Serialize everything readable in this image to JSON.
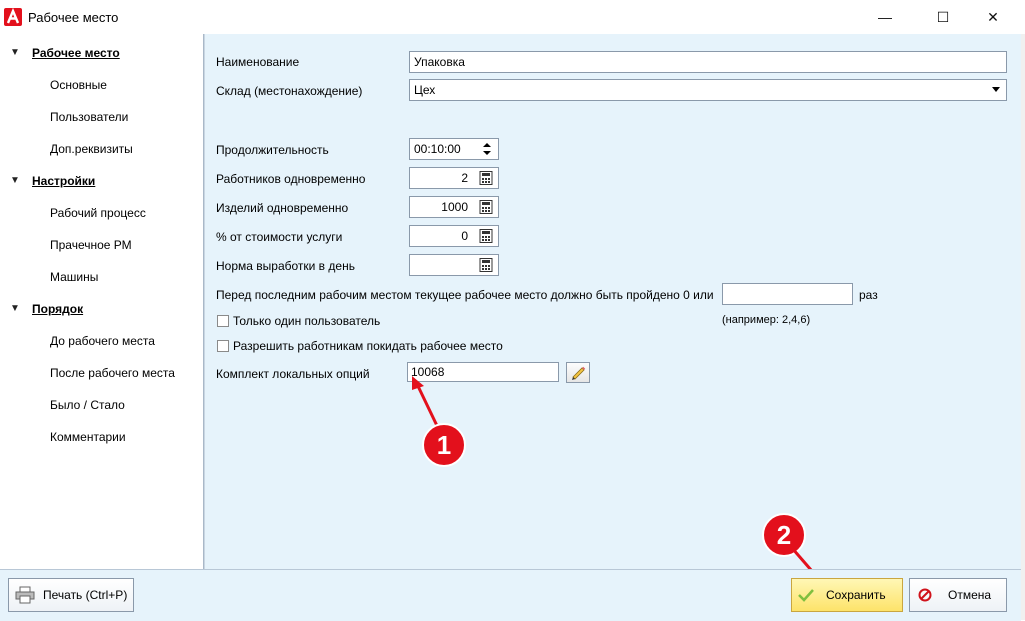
{
  "window": {
    "title": "Рабочее место",
    "controls": {
      "minimize": "—",
      "maximize": "☐",
      "close": "✕"
    }
  },
  "sidebar": {
    "groups": [
      {
        "label": "Рабочее место",
        "items": [
          "Основные",
          "Пользователи",
          "Доп.реквизиты"
        ]
      },
      {
        "label": "Настройки",
        "items": [
          "Рабочий процесс",
          "Прачечное РМ",
          "Машины"
        ]
      },
      {
        "label": "Порядок",
        "items": [
          "До рабочего места",
          "После рабочего места",
          "Было / Стало",
          "Комментарии"
        ]
      }
    ]
  },
  "form": {
    "name_label": "Наименование",
    "name_value": "Упаковка",
    "warehouse_label": "Склад (местонахождение)",
    "warehouse_value": "Цех",
    "duration_label": "Продолжительность",
    "duration_value": "00:10:00",
    "workers_label": "Работников одновременно",
    "workers_value": "2",
    "items_label": "Изделий одновременно",
    "items_value": "1000",
    "percent_label": "% от стоимости услуги",
    "percent_value": "0",
    "norm_label": "Норма выработки в день",
    "norm_value": "",
    "before_label": "Перед последним рабочим местом текущее рабочее место должно быть пройдено 0 или",
    "before_value": "",
    "before_unit": "раз",
    "before_hint": "(например: 2,4,6)",
    "single_user_label": "Только один пользователь",
    "allow_leave_label": "Разрешить работникам покидать рабочее место",
    "options_label": "Комплект локальных опций",
    "options_value": "10068"
  },
  "footer": {
    "print_label": "Печать (Ctrl+P)",
    "save_label": "Сохранить",
    "cancel_label": "Отмена"
  },
  "annotations": {
    "badge1": "1",
    "badge2": "2"
  },
  "colors": {
    "accent": "#e3101c",
    "content_bg": "#e6f3fb",
    "save_bg": "#fde36a"
  }
}
